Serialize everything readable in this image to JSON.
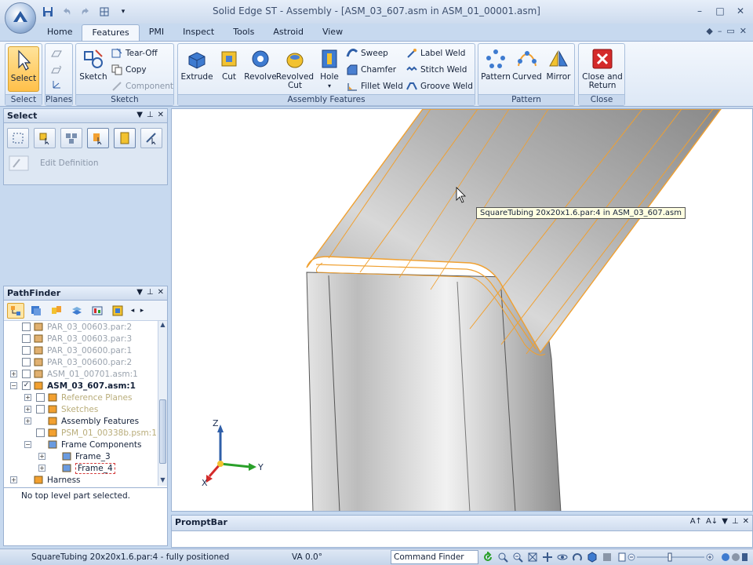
{
  "app": {
    "title": "Solid Edge ST - Assembly - [ASM_03_607.asm in ASM_01_00001.asm]",
    "window_controls": [
      "–",
      "□",
      "✕"
    ]
  },
  "tabs": [
    "Home",
    "Features",
    "PMI",
    "Inspect",
    "Tools",
    "Astroid",
    "View"
  ],
  "active_tab": "Features",
  "tab_right_controls": [
    "◆",
    "–",
    "▭",
    "✕"
  ],
  "ribbon": {
    "select": {
      "label": "Select",
      "group": "Select"
    },
    "planes": {
      "group": "Planes"
    },
    "sketch": {
      "label": "Sketch",
      "tear_off": "Tear-Off",
      "copy": "Copy",
      "component": "Component",
      "group": "Sketch"
    },
    "assembly_features": {
      "extrude": "Extrude",
      "cut": "Cut",
      "revolve": "Revolve",
      "revolved_cut_1": "Revolved",
      "revolved_cut_2": "Cut",
      "hole": "Hole",
      "sweep": "Sweep",
      "chamfer": "Chamfer",
      "fillet_weld": "Fillet Weld",
      "label_weld": "Label Weld",
      "stitch_weld": "Stitch Weld",
      "groove_weld": "Groove Weld",
      "group": "Assembly Features"
    },
    "pattern": {
      "pattern": "Pattern",
      "curved": "Curved",
      "mirror": "Mirror",
      "group": "Pattern"
    },
    "close": {
      "label_1": "Close and",
      "label_2": "Return",
      "group": "Close"
    }
  },
  "select_panel": {
    "title": "Select",
    "controls": [
      "▼",
      "⊥",
      "✕"
    ],
    "edit_definition": "Edit Definition"
  },
  "pathfinder": {
    "title": "PathFinder",
    "controls": [
      "▼",
      "⊥",
      "✕"
    ],
    "tree": [
      {
        "label": "PAR_03_00603.par:2",
        "style": "grey",
        "indent": 0,
        "expander": "",
        "check": ""
      },
      {
        "label": "PAR_03_00603.par:3",
        "style": "grey",
        "indent": 0,
        "expander": "",
        "check": ""
      },
      {
        "label": "PAR_03_00600.par:1",
        "style": "grey",
        "indent": 0,
        "expander": "",
        "check": ""
      },
      {
        "label": "PAR_03_00600.par:2",
        "style": "grey",
        "indent": 0,
        "expander": "",
        "check": ""
      },
      {
        "label": "ASM_01_00701.asm:1",
        "style": "grey",
        "indent": 0,
        "expander": "+",
        "check": ""
      },
      {
        "label": "ASM_03_607.asm:1",
        "style": "bold",
        "indent": 0,
        "expander": "−",
        "check": "✓"
      },
      {
        "label": "Reference Planes",
        "style": "yellowish",
        "indent": 1,
        "expander": "+",
        "check": ""
      },
      {
        "label": "Sketches",
        "style": "yellowish",
        "indent": 1,
        "expander": "+",
        "check": ""
      },
      {
        "label": "Assembly Features",
        "style": "normal",
        "indent": 1,
        "expander": "+",
        "check": "none"
      },
      {
        "label": "PSM_01_00338b.psm:1",
        "style": "yellowish",
        "indent": 1,
        "expander": "",
        "check": ""
      },
      {
        "label": "Frame Components",
        "style": "normal",
        "indent": 1,
        "expander": "−",
        "check": "none"
      },
      {
        "label": "Frame_3",
        "style": "normal",
        "indent": 2,
        "expander": "+",
        "check": "none"
      },
      {
        "label": "Frame_4",
        "style": "dashed",
        "indent": 2,
        "expander": "+",
        "check": "none"
      },
      {
        "label": "Harness",
        "style": "normal",
        "indent": 0,
        "expander": "+",
        "check": "none"
      }
    ],
    "status": "No top level part selected."
  },
  "viewport": {
    "tooltip": "SquareTubing 20x20x1.6.par:4 in ASM_03_607.asm",
    "triad": {
      "x": "X",
      "y": "Y",
      "z": "Z"
    }
  },
  "promptbar": {
    "title": "PromptBar",
    "controls": [
      "A↑",
      "A↓",
      "▼",
      "⊥",
      "✕"
    ]
  },
  "statusbar": {
    "message": "SquareTubing 20x20x1.6.par:4 - fully positioned",
    "view_angle": "VA 0.0°",
    "command_finder": "Command Finder"
  },
  "colors": {
    "accent": "#ffc04a",
    "highlight": "#f0a030",
    "ribbon": "#dde8f6"
  }
}
